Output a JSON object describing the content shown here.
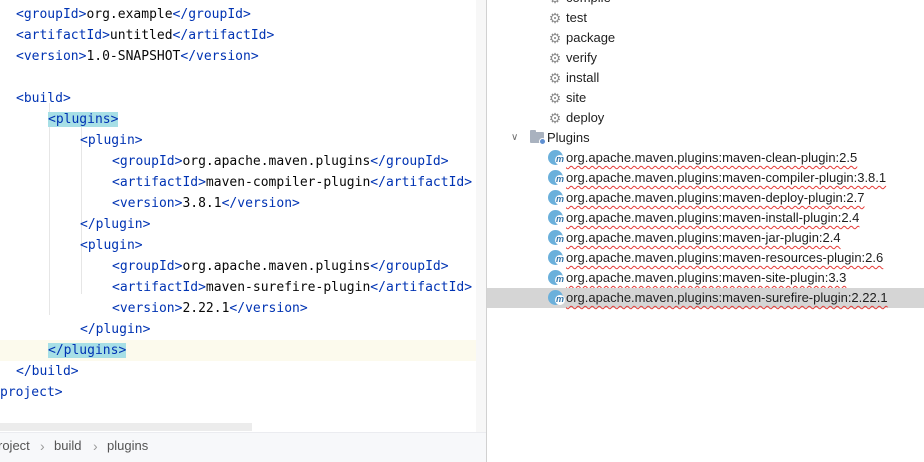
{
  "editor": {
    "lines": [
      [
        [
          "tag",
          "<groupId>"
        ],
        [
          "txt",
          "org.example"
        ],
        [
          "tag",
          "</groupId>"
        ]
      ],
      [
        [
          "tag",
          "<artifactId>"
        ],
        [
          "txt",
          "untitled"
        ],
        [
          "tag",
          "</artifactId>"
        ]
      ],
      [
        [
          "tag",
          "<version>"
        ],
        [
          "txt",
          "1.0-SNAPSHOT"
        ],
        [
          "tag",
          "</version>"
        ]
      ],
      [],
      [
        [
          "tag",
          "<build>"
        ]
      ],
      [
        [
          "tag",
          "<plugins>",
          "hl"
        ]
      ],
      [
        [
          "tag",
          "<plugin>"
        ]
      ],
      [
        [
          "tag",
          "<groupId>"
        ],
        [
          "txt",
          "org.apache.maven.plugins"
        ],
        [
          "tag",
          "</groupId>"
        ]
      ],
      [
        [
          "tag",
          "<artifactId>"
        ],
        [
          "txt",
          "maven-compiler-plugin"
        ],
        [
          "tag",
          "</artifactId>"
        ]
      ],
      [
        [
          "tag",
          "<version>"
        ],
        [
          "txt",
          "3.8.1"
        ],
        [
          "tag",
          "</version>"
        ]
      ],
      [
        [
          "tag",
          "</plugin>"
        ]
      ],
      [
        [
          "tag",
          "<plugin>"
        ]
      ],
      [
        [
          "tag",
          "<groupId>"
        ],
        [
          "txt",
          "org.apache.maven.plugins"
        ],
        [
          "tag",
          "</groupId>"
        ]
      ],
      [
        [
          "tag",
          "<artifactId>"
        ],
        [
          "txt",
          "maven-surefire-plugin"
        ],
        [
          "tag",
          "</artifactId>"
        ]
      ],
      [
        [
          "tag",
          "<version>"
        ],
        [
          "txt",
          "2.22.1"
        ],
        [
          "tag",
          "</version>"
        ]
      ],
      [
        [
          "tag",
          "</plugin>"
        ]
      ],
      [
        [
          "tag",
          "</plugins>",
          "hl"
        ]
      ],
      [
        [
          "tag",
          "</build>"
        ]
      ],
      [
        [
          "tag",
          "project>"
        ]
      ]
    ]
  },
  "breadcrumb": {
    "items": [
      "roject",
      "build",
      "plugins"
    ],
    "separator": "›"
  },
  "maven": {
    "lifecycle": [
      "compile",
      "test",
      "package",
      "verify",
      "install",
      "site",
      "deploy"
    ],
    "plugins_label": "Plugins",
    "plugins_chevron": "∨",
    "plugins": [
      "org.apache.maven.plugins:maven-clean-plugin:2.5",
      "org.apache.maven.plugins:maven-compiler-plugin:3.8.1",
      "org.apache.maven.plugins:maven-deploy-plugin:2.7",
      "org.apache.maven.plugins:maven-install-plugin:2.4",
      "org.apache.maven.plugins:maven-jar-plugin:2.4",
      "org.apache.maven.plugins:maven-resources-plugin:2.6",
      "org.apache.maven.plugins:maven-site-plugin:3.3",
      "org.apache.maven.plugins:maven-surefire-plugin:2.22.1"
    ],
    "selected_plugin_index": 7
  },
  "colors": {
    "tag": "#0033b3",
    "text": "#080808",
    "tag_highlight": "#a7dfe6",
    "current_line": "#fcfaed",
    "selection": "#d5d5d5",
    "spell_error": "#e53935"
  }
}
